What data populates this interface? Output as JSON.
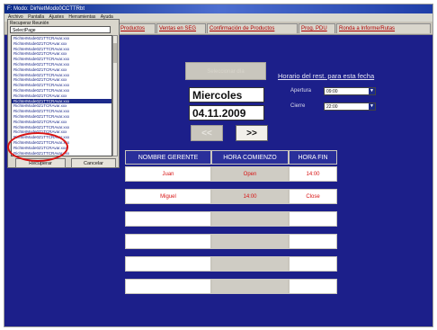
{
  "window": {
    "title": "F: Modo: DirNetModo0CCTTRbt"
  },
  "menubar": [
    "Archivo",
    "Pantalla",
    "Ajustes",
    "Herramientas",
    "Ayuda"
  ],
  "tabs": [
    "Productos",
    "Ventas en SEG",
    "Confirmación de Productos",
    "Prog. PDU",
    "Ronda a Informe/Rutas"
  ],
  "dropdown": {
    "label": "Recuperar Reunión",
    "selected": "SelectPage",
    "items": [
      "RichterMode0Z1TTCRAvar.xxx",
      "RichterMode0Z1TCRAvar.xxx",
      "RichterMode0Z1TTCRAvar.xxx",
      "RichterMode0Z1TCRAvar.xxx",
      "RichterMode0Z1TTCRAvar.xxx",
      "RichterMode0Z1TTCRAvar.xxx",
      "RichterMode0Z1TCRAvar.xxx",
      "RichterMode0Z1TTCRAvar.xxx",
      "RichterMode0Z1TCRAvar.xxx",
      "RichterMode0Z1TTCRAvar.xxx",
      "RichterMode0Z1TTCRAvar.xxx",
      "RichterMode0Z1TCRAvar.xxx",
      "RichterMode0Z1TTCRAvar.xxx",
      "RichterMode0Z1TCRAvar.xxx",
      "RichterMode0Z1TTCRAvar.xxx",
      "RichterMode0Z1TTCRAvar.xxx",
      "RichterMode0Z1TCRAvar.xxx",
      "RichterMode0Z1TTCRAvar.xxx",
      "RichterMode0Z1TCRAvar.xxx",
      "RichterMode0Z1TTCRAvar.xxx",
      "RichterMode0Z1TTCRAvar.xxx",
      "RichterMode0Z1TCRAvar.xxx",
      "RichterMode0Z1TTCRAvar.xxx"
    ],
    "selected_index": 12,
    "recover_label": "Recuperar",
    "cancel_label": "Cancelar"
  },
  "date": {
    "select_label": "Seleccionar día",
    "day_name": "Miercoles",
    "date": "04.11.2009",
    "prev_label": "<<",
    "next_label": ">>"
  },
  "hours": {
    "title": "Horario del rest. para esta fecha",
    "opening_label": "Apertura",
    "opening_value": "09:00",
    "closing_label": "Cierre",
    "closing_value": "22:00"
  },
  "table": {
    "headers": [
      "NOMBRE GERENTE",
      "HORA COMIENZO",
      "HORA FIN"
    ],
    "rows": [
      [
        "Juan",
        "Open",
        "14:00"
      ],
      [
        "Miguel",
        "14:00",
        "Close"
      ],
      [
        "",
        "",
        ""
      ],
      [
        "",
        "",
        ""
      ],
      [
        "",
        "",
        ""
      ],
      [
        "",
        "",
        ""
      ]
    ]
  },
  "colors": {
    "background": "#1c1f8a",
    "accent": "#d81414",
    "panel": "#d9d6cc"
  }
}
